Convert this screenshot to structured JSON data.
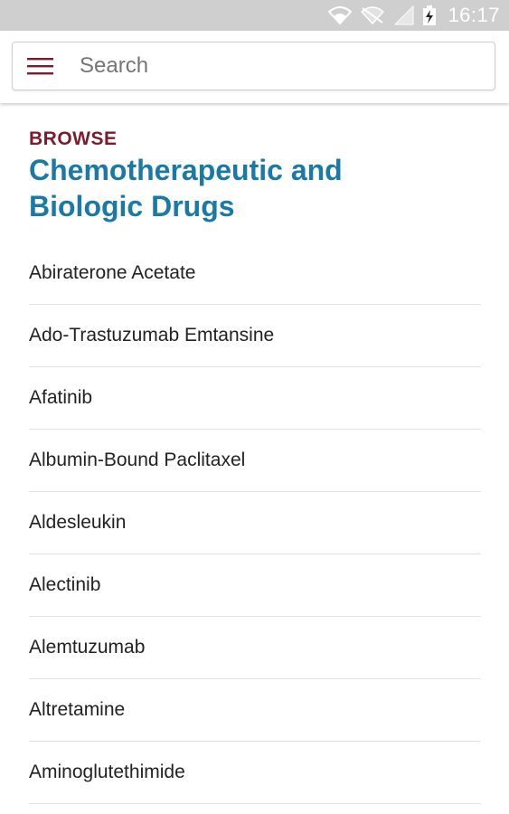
{
  "status_bar": {
    "time": "16:17",
    "icons": [
      "wifi-icon",
      "wifi-off-icon",
      "signal-icon",
      "battery-charging-icon"
    ]
  },
  "toolbar": {
    "menu_icon": "hamburger-menu-icon",
    "search": {
      "placeholder": "Search",
      "value": ""
    }
  },
  "header": {
    "eyebrow": "BROWSE",
    "title_line1": "Chemotherapeutic and",
    "title_line2": "Biologic Drugs"
  },
  "drugs": [
    {
      "label": "Abiraterone Acetate"
    },
    {
      "label": "Ado-Trastuzumab Emtansine"
    },
    {
      "label": "Afatinib"
    },
    {
      "label": "Albumin-Bound Paclitaxel"
    },
    {
      "label": "Aldesleukin"
    },
    {
      "label": "Alectinib"
    },
    {
      "label": "Alemtuzumab"
    },
    {
      "label": "Altretamine"
    },
    {
      "label": "Aminoglutethimide"
    }
  ],
  "colors": {
    "accent_maroon": "#7b1c2e",
    "title_blue": "#1a7aa5",
    "status_bar_bg": "#cfcfcf"
  }
}
